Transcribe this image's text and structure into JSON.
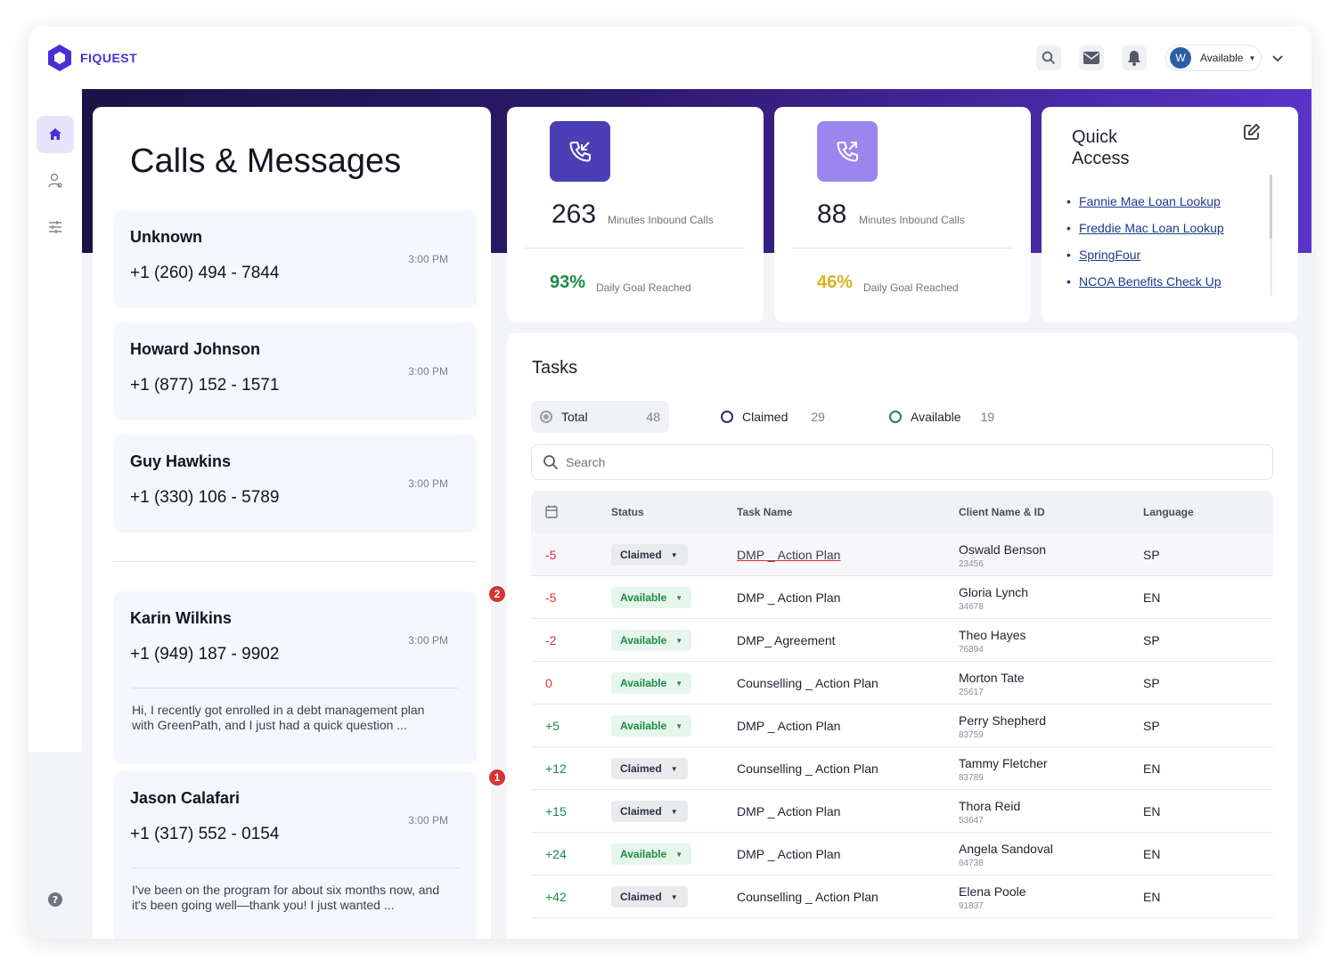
{
  "app": {
    "logo_text": "FIQUEST"
  },
  "topbar": {
    "avatar_initial": "W",
    "status": "Available"
  },
  "calls": {
    "title": "Calls & Messages",
    "items": [
      {
        "name": "Unknown",
        "phone": "+1 (260) 494 - 7844",
        "time": "3:00 PM"
      },
      {
        "name": "Howard Johnson",
        "phone": "+1 (877) 152 - 1571",
        "time": "3:00 PM"
      },
      {
        "name": "Guy Hawkins",
        "phone": "+1 (330) 106 - 5789",
        "time": "3:00 PM"
      }
    ],
    "messages": [
      {
        "name": "Karin Wilkins",
        "phone": "+1 (949) 187 - 9902",
        "time": "3:00 PM",
        "badge": "2",
        "preview": "Hi, I recently got enrolled in a debt management plan with GreenPath, and I just had a quick question ..."
      },
      {
        "name": "Jason Calafari",
        "phone": "+1 (317) 552 - 0154",
        "time": "3:00 PM",
        "badge": "1",
        "preview": "I've been on the program for about six months now, and it's been going well—thank you! I just wanted ..."
      }
    ]
  },
  "stats": [
    {
      "value": "263",
      "label": "Minutes Inbound Calls",
      "pct": "93%",
      "goal_label": "Daily Goal Reached",
      "icon": "phone-incoming-icon",
      "icon_bg": "#4b3fb5",
      "pct_color": "#1c8a45"
    },
    {
      "value": "88",
      "label": "Minutes Inbound Calls",
      "pct": "46%",
      "goal_label": "Daily Goal Reached",
      "icon": "phone-outgoing-icon",
      "icon_bg": "#9b86f0",
      "pct_color": "#d9b21f"
    }
  ],
  "quick_access": {
    "title": "Quick Access",
    "links": [
      "Fannie Mae Loan Lookup",
      "Freddie Mac Loan Lookup",
      "SpringFour",
      "NCOA Benefits Check Up"
    ]
  },
  "tasks": {
    "title": "Tasks",
    "filters": {
      "total_label": "Total",
      "total_count": "48",
      "claimed_label": "Claimed",
      "claimed_count": "29",
      "available_label": "Available",
      "available_count": "19"
    },
    "search_placeholder": "Search",
    "columns": [
      "Status",
      "Task Name",
      "Client Name & ID",
      "Language"
    ],
    "rows": [
      {
        "priority": "-5",
        "status": "Claimed",
        "task": "DMP _ Action Plan",
        "client": "Oswald Benson",
        "id": "23456",
        "lang": "SP"
      },
      {
        "priority": "-5",
        "status": "Available",
        "task": "DMP _ Action Plan",
        "client": "Gloria Lynch",
        "id": "34678",
        "lang": "EN"
      },
      {
        "priority": "-2",
        "status": "Available",
        "task": "DMP_ Agreement",
        "client": "Theo Hayes",
        "id": "76894",
        "lang": "SP"
      },
      {
        "priority": "0",
        "status": "Available",
        "task": "Counselling _ Action Plan",
        "client": "Morton Tate",
        "id": "25617",
        "lang": "SP"
      },
      {
        "priority": "+5",
        "status": "Available",
        "task": "DMP _ Action Plan",
        "client": "Perry Shepherd",
        "id": "83759",
        "lang": "SP"
      },
      {
        "priority": "+12",
        "status": "Claimed",
        "task": "Counselling _ Action Plan",
        "client": "Tammy Fletcher",
        "id": "83789",
        "lang": "EN"
      },
      {
        "priority": "+15",
        "status": "Claimed",
        "task": "DMP _ Action Plan",
        "client": "Thora Reid",
        "id": "53647",
        "lang": "EN"
      },
      {
        "priority": "+24",
        "status": "Available",
        "task": "DMP _ Action Plan",
        "client": "Angela Sandoval",
        "id": "64738",
        "lang": "EN"
      },
      {
        "priority": "+42",
        "status": "Claimed",
        "task": "Counselling _ Action Plan",
        "client": "Elena Poole",
        "id": "91837",
        "lang": "EN"
      }
    ]
  },
  "colors": {
    "accent": "#4a2fd6",
    "negative": "#d63333",
    "positive": "#1c8a45"
  }
}
